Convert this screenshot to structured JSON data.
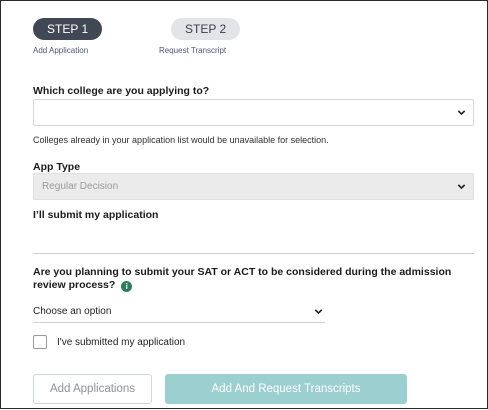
{
  "steps": [
    {
      "pill": "STEP 1",
      "label": "Add Application"
    },
    {
      "pill": "STEP 2",
      "label": "Request Transcript"
    }
  ],
  "college": {
    "question": "Which college are you applying to?",
    "value": "",
    "note": "Colleges already in your application list would be unavailable for selection."
  },
  "app_type": {
    "label": "App Type",
    "value": "Regular Decision"
  },
  "submit_field": {
    "label": "I’ll submit my application",
    "value": ""
  },
  "test_question": {
    "line1": "Are you planning to submit your SAT or ACT to be considered during the admission",
    "line2": "review process?",
    "info_icon": "i",
    "select_value": "Choose an option"
  },
  "checkbox": {
    "label": "I've submitted my application",
    "checked": false
  },
  "buttons": {
    "add": "Add Applications",
    "request": "Add And Request Transcripts"
  },
  "colors": {
    "step_active": "#414855",
    "step_inactive": "#e3e4e8",
    "info_icon": "#2e7d5a",
    "primary_button": "#9ccfcf"
  }
}
